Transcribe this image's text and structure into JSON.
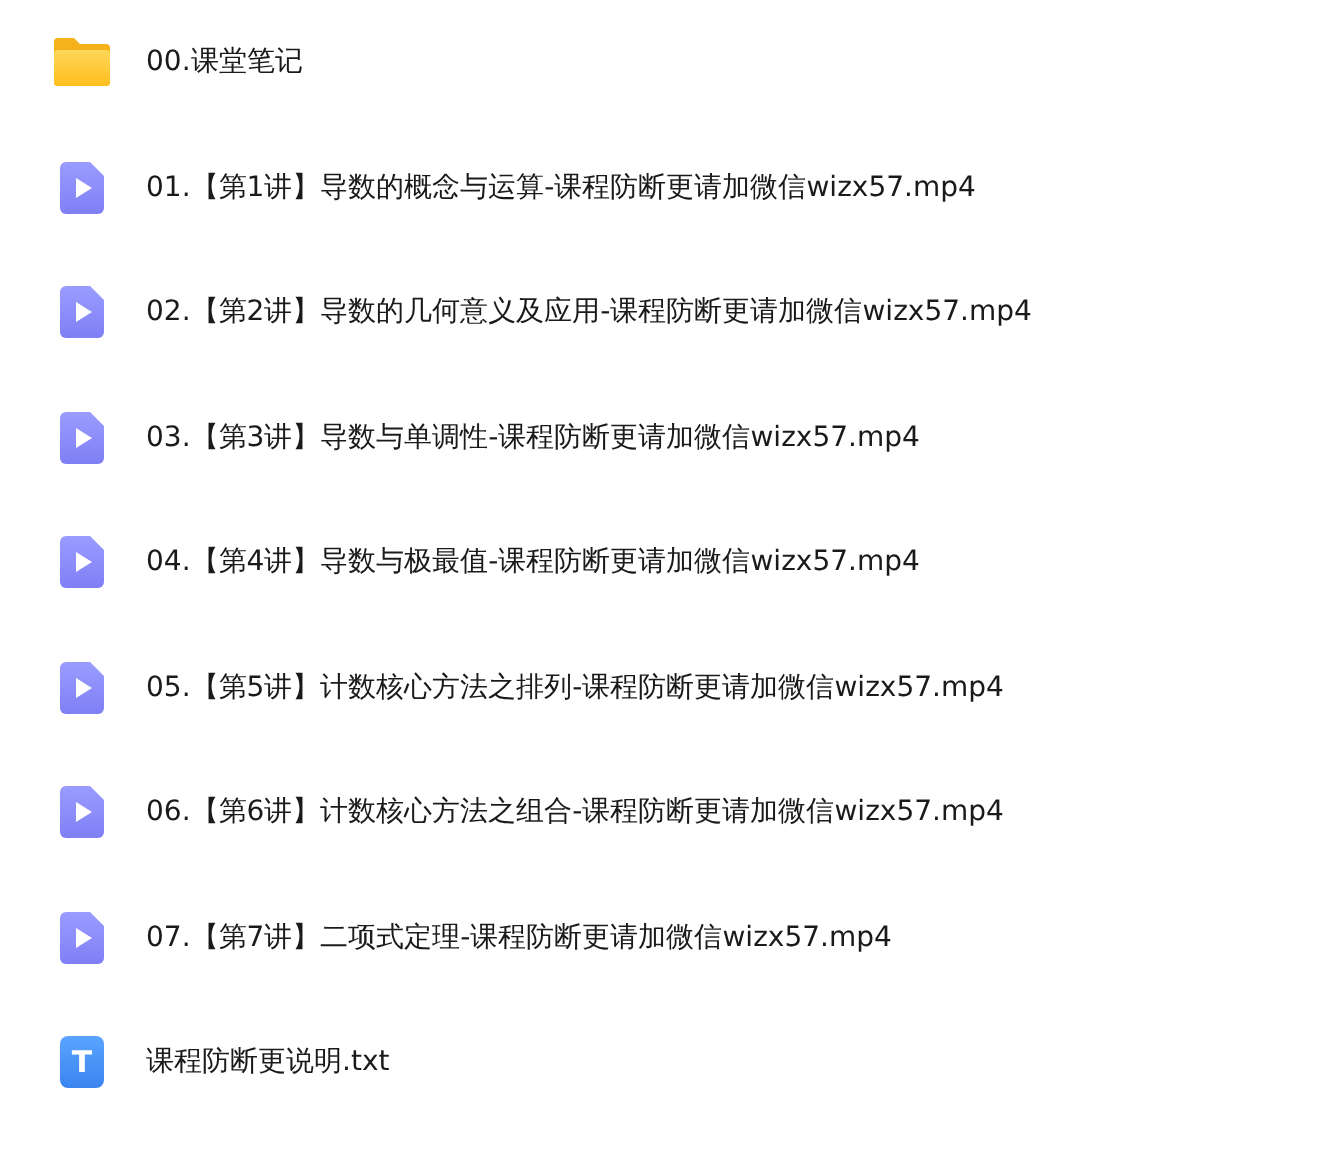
{
  "files": [
    {
      "kind": "folder",
      "name": "00.课堂笔记"
    },
    {
      "kind": "video",
      "name": "01.【第1讲】导数的概念与运算-课程防断更请加微信wizx57.mp4"
    },
    {
      "kind": "video",
      "name": "02.【第2讲】导数的几何意义及应用-课程防断更请加微信wizx57.mp4"
    },
    {
      "kind": "video",
      "name": "03.【第3讲】导数与单调性-课程防断更请加微信wizx57.mp4"
    },
    {
      "kind": "video",
      "name": "04.【第4讲】导数与极最值-课程防断更请加微信wizx57.mp4"
    },
    {
      "kind": "video",
      "name": "05.【第5讲】计数核心方法之排列-课程防断更请加微信wizx57.mp4"
    },
    {
      "kind": "video",
      "name": "06.【第6讲】计数核心方法之组合-课程防断更请加微信wizx57.mp4"
    },
    {
      "kind": "video",
      "name": "07.【第7讲】二项式定理-课程防断更请加微信wizx57.mp4"
    },
    {
      "kind": "text",
      "name": "课程防断更说明.txt",
      "icon_glyph": "T"
    }
  ]
}
